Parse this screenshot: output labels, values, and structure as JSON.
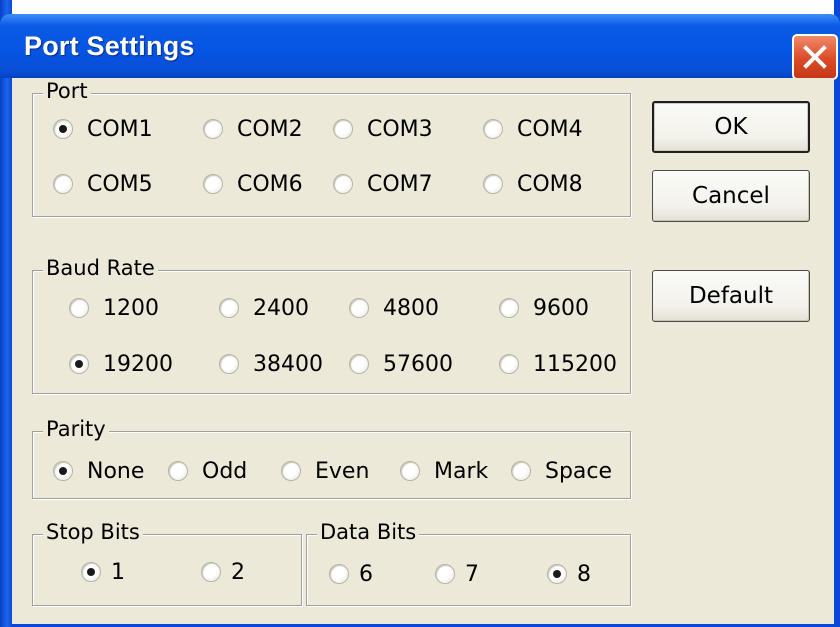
{
  "window": {
    "title": "Port Settings"
  },
  "groups": {
    "port": {
      "label": "Port",
      "options": [
        "COM1",
        "COM2",
        "COM3",
        "COM4",
        "COM5",
        "COM6",
        "COM7",
        "COM8"
      ],
      "selected": "COM1"
    },
    "baud": {
      "label": "Baud Rate",
      "options": [
        "1200",
        "2400",
        "4800",
        "9600",
        "19200",
        "38400",
        "57600",
        "115200"
      ],
      "selected": "19200"
    },
    "parity": {
      "label": "Parity",
      "options": [
        "None",
        "Odd",
        "Even",
        "Mark",
        "Space"
      ],
      "selected": "None"
    },
    "stopbits": {
      "label": "Stop Bits",
      "options": [
        "1",
        "2"
      ],
      "selected": "1"
    },
    "databits": {
      "label": "Data Bits",
      "options": [
        "6",
        "7",
        "8"
      ],
      "selected": "8"
    }
  },
  "buttons": {
    "ok": "OK",
    "cancel": "Cancel",
    "default": "Default"
  },
  "colors": {
    "titlebar": "#0554e3",
    "client": "#ece9d8",
    "close": "#dc4a26"
  },
  "icons": {
    "close": "close-icon"
  }
}
